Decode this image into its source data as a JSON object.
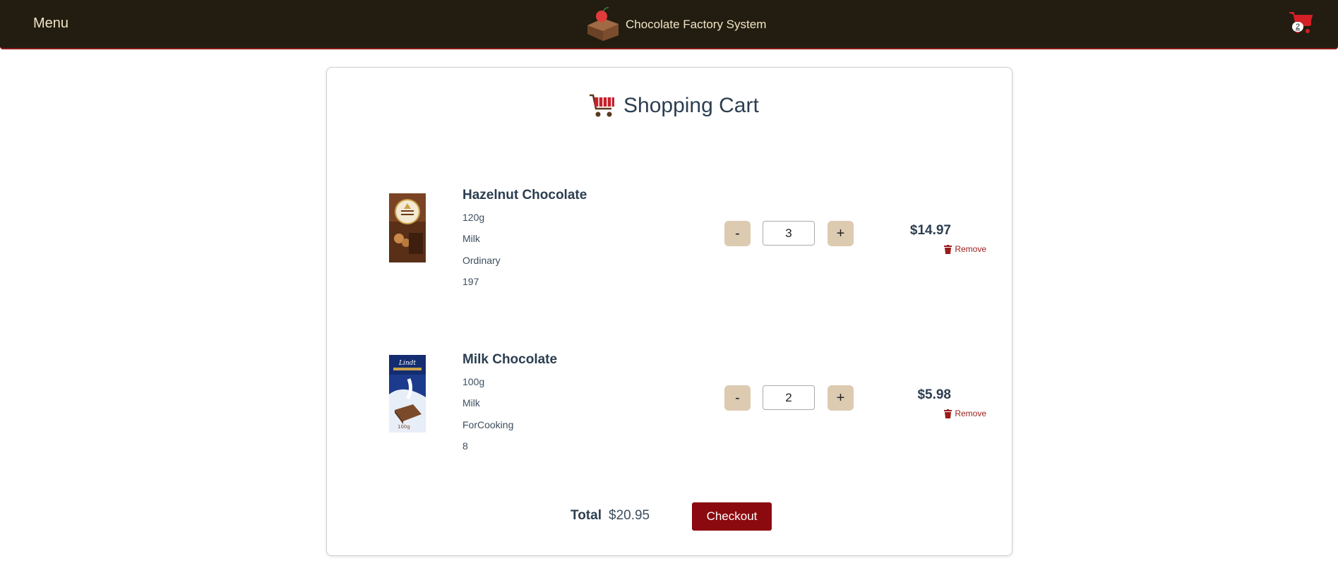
{
  "navbar": {
    "menu_label": "Menu",
    "brand_title": "Chocolate Factory System",
    "cart_count": "2",
    "logo_icon": "chocolate-cake-icon",
    "cart_icon": "shopping-cart-icon"
  },
  "cart": {
    "heading": "Shopping Cart",
    "heading_icon": "shopping-cart-icon",
    "items": [
      {
        "name": "Hazelnut Chocolate",
        "attributes": [
          "120g",
          "Milk",
          "Ordinary",
          "197"
        ],
        "quantity": "3",
        "price": "$14.97",
        "remove_label": "Remove",
        "image": "hazelnut-chocolate-bar"
      },
      {
        "name": "Milk Chocolate",
        "attributes": [
          "100g",
          "Milk",
          "ForCooking",
          "8"
        ],
        "quantity": "2",
        "price": "$5.98",
        "remove_label": "Remove",
        "image": "milk-chocolate-bar"
      }
    ],
    "decrement_label": "-",
    "increment_label": "+",
    "total_label": "Total",
    "total_value": "$20.95",
    "checkout_label": "Checkout"
  },
  "colors": {
    "navbar_bg": "#221d10",
    "accent_red": "#8b0a0f",
    "qty_button_bg": "#dccbb1",
    "text_dark": "#2c3e50"
  }
}
